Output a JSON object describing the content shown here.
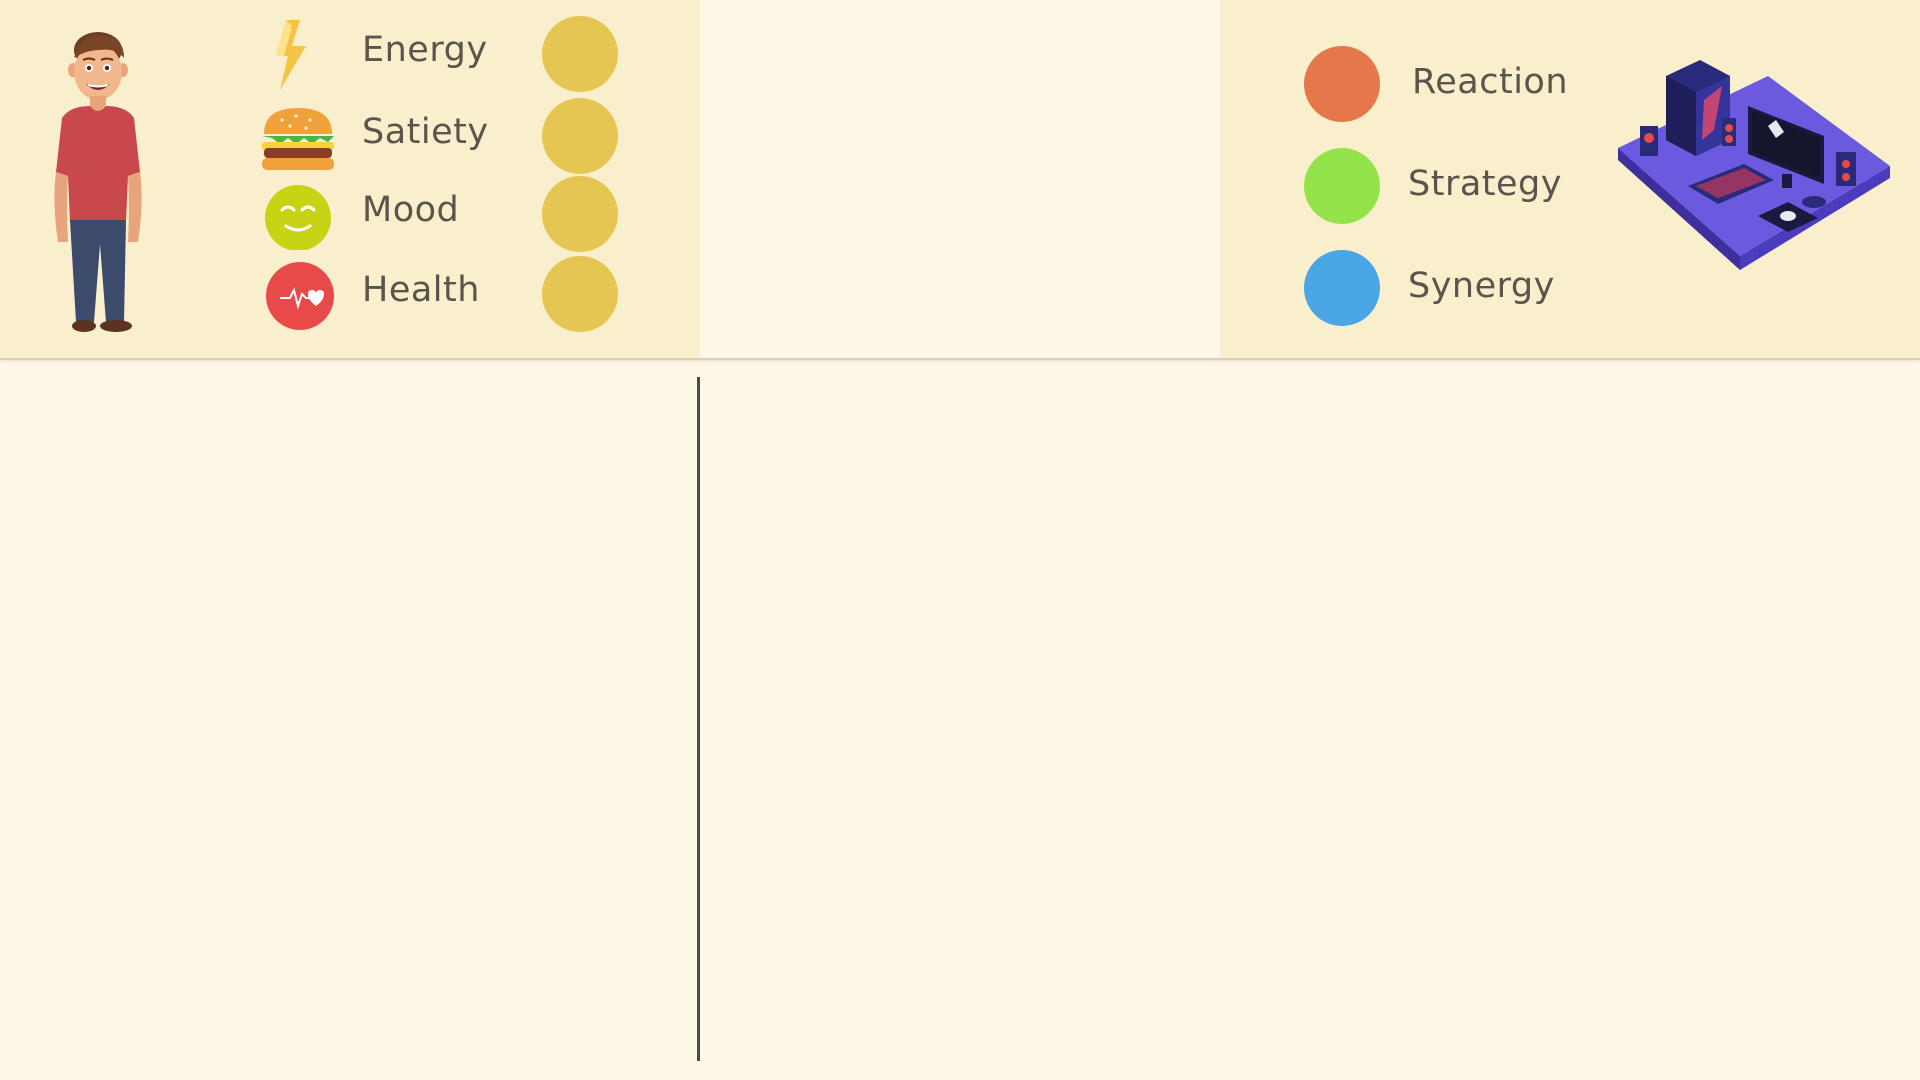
{
  "stats": [
    {
      "label": "Energy",
      "icon": "lightning-icon",
      "dot_color": "#e6c652"
    },
    {
      "label": "Satiety",
      "icon": "burger-icon",
      "dot_color": "#e6c652"
    },
    {
      "label": "Mood",
      "icon": "smiley-icon",
      "dot_color": "#e6c652"
    },
    {
      "label": "Health",
      "icon": "heartbeat-icon",
      "dot_color": "#e6c652"
    }
  ],
  "skills": [
    {
      "label": "Reaction",
      "color": "#e5774a"
    },
    {
      "label": "Strategy",
      "color": "#95e34a"
    },
    {
      "label": "Synergy",
      "color": "#4aa6e6"
    }
  ],
  "colors": {
    "background": "#fef8e6",
    "panel": "#f9efcd",
    "stat_dot": "#e6c652",
    "text": "#5a554b"
  }
}
